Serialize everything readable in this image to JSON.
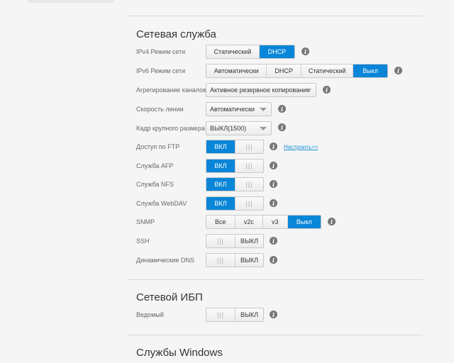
{
  "sections": {
    "network": "Сетевая служба",
    "ups": "Сетевой ИБП",
    "windows": "Службы Windows"
  },
  "rows": {
    "ipv4": {
      "label": "IPv4 Режим сети",
      "options": [
        "Статический",
        "DHCP"
      ],
      "selected": "DHCP"
    },
    "ipv6": {
      "label": "IPv6 Режим сети",
      "options": [
        "Автоматически",
        "DHCP",
        "Статический",
        "Выкл"
      ],
      "selected": "Выкл"
    },
    "aggregation": {
      "label": "Агрегирование каналов",
      "value": "Активное резервное копирование"
    },
    "speed": {
      "label": "Скорость линии",
      "value": "Автоматически"
    },
    "jumbo": {
      "label": "Кадр крупного размера",
      "value": "ВЫКЛ(1500)"
    },
    "ftp": {
      "label": "Доступ по FTP",
      "state": "ВКЛ",
      "link": "Настроить>>"
    },
    "afp": {
      "label": "Служба AFP",
      "state": "ВКЛ"
    },
    "nfs": {
      "label": "Служба NFS",
      "state": "ВКЛ"
    },
    "webdav": {
      "label": "Служба WebDAV",
      "state": "ВКЛ"
    },
    "snmp": {
      "label": "SNMP",
      "options": [
        "Все",
        "v2c",
        "v3",
        "Выкл"
      ],
      "selected": "Выкл"
    },
    "ssh": {
      "label": "SSH",
      "state": "ВЫКЛ"
    },
    "ddns": {
      "label": "Динамические DNS",
      "state": "ВЫКЛ"
    },
    "slave": {
      "label": "Ведомый",
      "state": "ВЫКЛ"
    }
  },
  "toggle_grip": "|||",
  "info_glyph": "i",
  "colors": {
    "accent": "#0a86d8",
    "link": "#1a8fd6"
  }
}
